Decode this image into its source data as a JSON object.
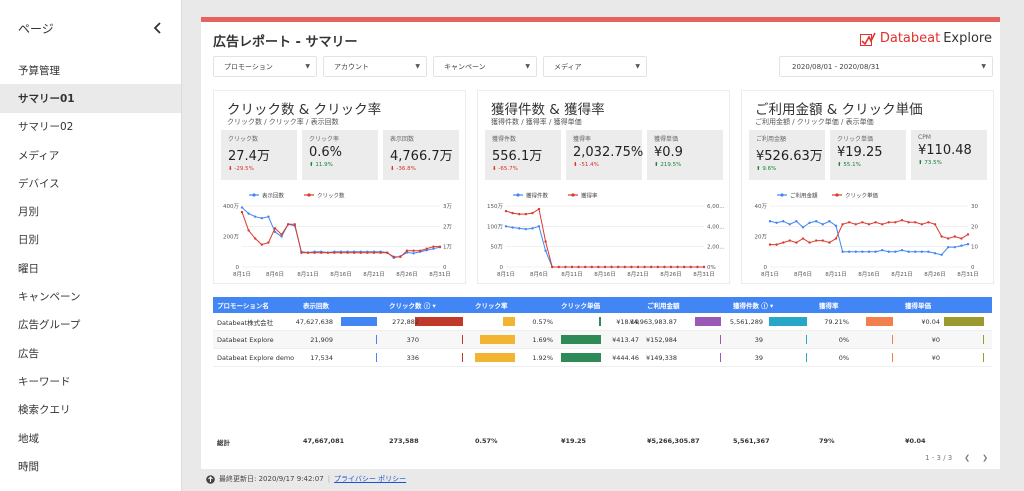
{
  "sidebar": {
    "title": "ページ",
    "items": [
      "予算管理",
      "サマリー01",
      "サマリー02",
      "メディア",
      "デバイス",
      "月別",
      "日別",
      "曜日",
      "キャンペーン",
      "広告グループ",
      "広告",
      "キーワード",
      "検索クエリ",
      "地域",
      "時間"
    ],
    "active": "サマリー01"
  },
  "report": {
    "title": "広告レポート - サマリー",
    "logo_brand": "Databeat",
    "logo_product": "Explore"
  },
  "filters": [
    "プロモーション",
    "アカウント",
    "キャンペーン",
    "メディア"
  ],
  "date_range": "2020/08/01 - 2020/08/31",
  "cards": [
    {
      "title": "クリック数 & クリック率",
      "subtitle": "クリック数 / クリック率 / 表示回数",
      "kpis": [
        {
          "label": "クリック数",
          "value": "27.4万",
          "change": "-29.5%",
          "dir": "down"
        },
        {
          "label": "クリック率",
          "value": "0.6%",
          "change": "11.9%",
          "dir": "up"
        },
        {
          "label": "表示回数",
          "value": "4,766.7万",
          "change": "-36.8%",
          "dir": "down"
        }
      ],
      "legend": [
        "表示回数",
        "クリック数"
      ],
      "left_ticks": [
        "400万",
        "200万",
        "0"
      ],
      "right_ticks": [
        "3万",
        "2万",
        "1万",
        "0"
      ]
    },
    {
      "title": "獲得件数 & 獲得率",
      "subtitle": "獲得件数 / 獲得率 / 獲得単価",
      "kpis": [
        {
          "label": "獲得件数",
          "value": "556.1万",
          "change": "-65.7%",
          "dir": "down"
        },
        {
          "label": "獲得率",
          "value": "2,032.75%",
          "change": "-51.4%",
          "dir": "down"
        },
        {
          "label": "獲得単価",
          "value": "¥0.9",
          "change": "219.5%",
          "dir": "up"
        }
      ],
      "legend": [
        "獲得件数",
        "獲得率"
      ],
      "left_ticks": [
        "150万",
        "100万",
        "50万",
        "0"
      ],
      "right_ticks": [
        "6,00...",
        "4,00...",
        "2,00...",
        "0%"
      ]
    },
    {
      "title": "ご利用金額 & クリック単価",
      "subtitle": "ご利用金額 / クリック単価 / 表示単価",
      "kpis": [
        {
          "label": "ご利用金額",
          "value": "¥526.63万",
          "change": "9.6%",
          "dir": "up"
        },
        {
          "label": "クリック単価",
          "value": "¥19.25",
          "change": "55.1%",
          "dir": "up"
        },
        {
          "label": "CPM",
          "value": "¥110.48",
          "change": "73.5%",
          "dir": "up"
        }
      ],
      "legend": [
        "ご利用金額",
        "クリック単価"
      ],
      "left_ticks": [
        "40万",
        "20万",
        "0"
      ],
      "right_ticks": [
        "30",
        "20",
        "10",
        "0"
      ]
    }
  ],
  "x_ticks": [
    "8月1日",
    "8月6日",
    "8月11日",
    "8月16日",
    "8月21日",
    "8月26日",
    "8月31日"
  ],
  "chart_data": [
    {
      "type": "line",
      "x": [
        "8月1日",
        "8月2日",
        "8月3日",
        "8月4日",
        "8月5日",
        "8月6日",
        "8月7日",
        "8月8日",
        "8月9日",
        "8月10日",
        "8月11日",
        "8月12日",
        "8月13日",
        "8月14日",
        "8月15日",
        "8月16日",
        "8月17日",
        "8月18日",
        "8月19日",
        "8月20日",
        "8月21日",
        "8月22日",
        "8月23日",
        "8月24日",
        "8月25日",
        "8月26日",
        "8月27日",
        "8月28日",
        "8月29日",
        "8月30日",
        "8月31日"
      ],
      "series": [
        {
          "name": "表示回数",
          "axis": "left",
          "values": [
            390,
            350,
            330,
            320,
            330,
            230,
            200,
            280,
            270,
            100,
            95,
            100,
            100,
            95,
            100,
            100,
            100,
            100,
            100,
            100,
            100,
            100,
            95,
            60,
            70,
            95,
            90,
            100,
            110,
            120,
            130
          ]
        },
        {
          "name": "クリック数",
          "axis": "right",
          "values": [
            2.7,
            1.8,
            1.4,
            1.1,
            1.2,
            1.9,
            1.6,
            2.1,
            2.1,
            0.7,
            0.7,
            0.7,
            0.7,
            0.7,
            0.7,
            0.7,
            0.7,
            0.7,
            0.7,
            0.7,
            0.7,
            0.7,
            0.7,
            0.5,
            0.5,
            0.8,
            0.8,
            0.8,
            0.9,
            1.0,
            1.0
          ]
        }
      ],
      "ylim_left": [
        0,
        400
      ],
      "ylim_right": [
        0,
        3
      ]
    },
    {
      "type": "line",
      "x": [
        "8月1日",
        "8月2日",
        "8月3日",
        "8月4日",
        "8月5日",
        "8月6日",
        "8月7日",
        "8月8日",
        "8月9日",
        "8月10日",
        "8月11日",
        "8月12日",
        "8月13日",
        "8月14日",
        "8月15日",
        "8月16日",
        "8月17日",
        "8月18日",
        "8月19日",
        "8月20日",
        "8月21日",
        "8月22日",
        "8月23日",
        "8月24日",
        "8月25日",
        "8月26日",
        "8月27日",
        "8月28日",
        "8月29日",
        "8月30日",
        "8月31日"
      ],
      "series": [
        {
          "name": "獲得件数",
          "axis": "left",
          "values": [
            100,
            97,
            95,
            93,
            95,
            100,
            40,
            0,
            0,
            0,
            0,
            0,
            0,
            0,
            0,
            0,
            0,
            0,
            0,
            0,
            0,
            0,
            0,
            0,
            0,
            0,
            0,
            0,
            0,
            0,
            0
          ]
        },
        {
          "name": "獲得率",
          "axis": "right",
          "values": [
            5500,
            5300,
            5200,
            5200,
            5300,
            5700,
            2500,
            0,
            0,
            0,
            0,
            0,
            0,
            0,
            0,
            0,
            0,
            0,
            0,
            0,
            0,
            0,
            0,
            0,
            0,
            0,
            0,
            0,
            0,
            0,
            0
          ]
        }
      ],
      "ylim_left": [
        0,
        150
      ],
      "ylim_right": [
        0,
        6000
      ]
    },
    {
      "type": "line",
      "x": [
        "8月1日",
        "8月2日",
        "8月3日",
        "8月4日",
        "8月5日",
        "8月6日",
        "8月7日",
        "8月8日",
        "8月9日",
        "8月10日",
        "8月11日",
        "8月12日",
        "8月13日",
        "8月14日",
        "8月15日",
        "8月16日",
        "8月17日",
        "8月18日",
        "8月19日",
        "8月20日",
        "8月21日",
        "8月22日",
        "8月23日",
        "8月24日",
        "8月25日",
        "8月26日",
        "8月27日",
        "8月28日",
        "8月29日",
        "8月30日",
        "8月31日"
      ],
      "series": [
        {
          "name": "ご利用金額",
          "axis": "left",
          "values": [
            30,
            29,
            30,
            28,
            30,
            26,
            29,
            30,
            28,
            30,
            27,
            10,
            10,
            10,
            10,
            10,
            10,
            11,
            10,
            10,
            11,
            10,
            10,
            10,
            10,
            9,
            8,
            13,
            13,
            14,
            15
          ]
        },
        {
          "name": "クリック単価",
          "axis": "right",
          "values": [
            11,
            11,
            12,
            13,
            12,
            14,
            12,
            13,
            13,
            12,
            14,
            21,
            22,
            21,
            22,
            21,
            22,
            21,
            22,
            22,
            23,
            22,
            22,
            21,
            22,
            21,
            15,
            14,
            15,
            14,
            16
          ]
        }
      ],
      "ylim_left": [
        0,
        40
      ],
      "ylim_right": [
        0,
        30
      ]
    }
  ],
  "table": {
    "headers": [
      "プロモーション名",
      "表示回数",
      "クリック数 ⓘ ▾",
      "クリック率",
      "クリック単価",
      "ご利用金額",
      "獲得件数 ⓘ ▾",
      "獲得率",
      "獲得単価"
    ],
    "rows": [
      [
        "Databeat株式会社",
        "47,627,638",
        "272,882",
        "0.57%",
        "¥18.19",
        "¥4,963,983.87",
        "5,561,289",
        "79.21%",
        "¥0.04"
      ],
      [
        "Databeat Explore",
        "21,909",
        "370",
        "1.69%",
        "¥413.47",
        "¥152,984",
        "39",
        "0%",
        "¥0"
      ],
      [
        "Databeat Explore demo",
        "17,534",
        "336",
        "1.92%",
        "¥444.46",
        "¥149,338",
        "39",
        "0%",
        "¥0"
      ]
    ],
    "bar_fracs": [
      [
        1,
        1,
        0.3,
        0.05,
        1,
        1,
        0.67,
        1
      ],
      [
        0.005,
        0.01,
        0.88,
        1,
        0.03,
        0.01,
        0.01,
        0
      ],
      [
        0.004,
        0.01,
        1,
        1,
        0.03,
        0.01,
        0.01,
        0
      ]
    ],
    "bar_colors": [
      "#4285f4",
      "#c0392b",
      "#f2b531",
      "#2e8b57",
      "#9b59b6",
      "#26a7c7",
      "#f47f4e",
      "#9a9a2e"
    ],
    "totals": [
      "総計",
      "47,667,081",
      "273,588",
      "0.57%",
      "¥19.25",
      "¥5,266,305.87",
      "5,561,367",
      "79%",
      "¥0.04"
    ]
  },
  "pager": "1 - 3 / 3",
  "footer": {
    "updated": "最終更新日: 2020/9/17 9:42:07",
    "policy": "プライバシー ポリシー"
  },
  "colors": {
    "blue": "#4285f4",
    "red": "#d93b2f",
    "accent": "#e8625f"
  }
}
